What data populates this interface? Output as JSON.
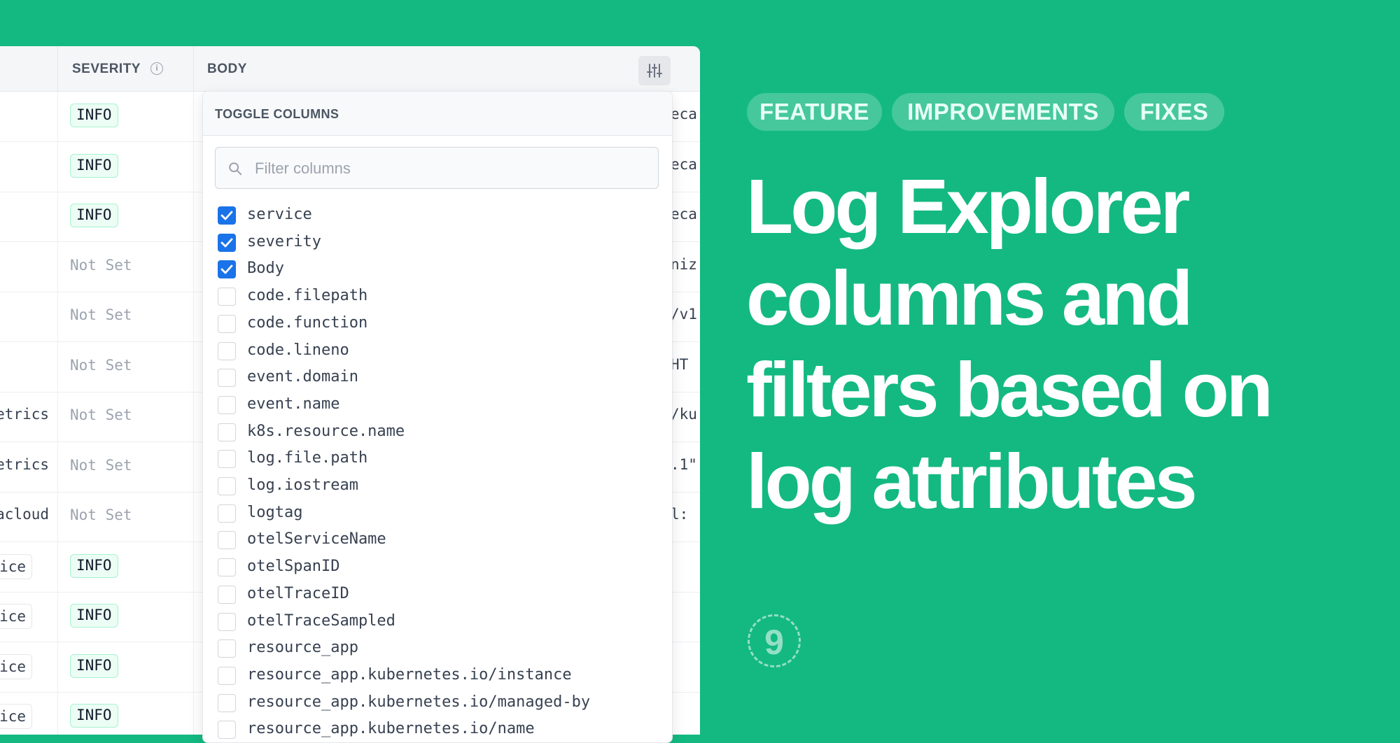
{
  "table": {
    "headers": {
      "severity": "SEVERITY",
      "body": "BODY"
    },
    "rows": [
      {
        "service": "",
        "severity": "INFO",
        "body": "eca"
      },
      {
        "service": "",
        "severity": "INFO",
        "body": "eca"
      },
      {
        "service": "",
        "severity": "INFO",
        "body": "eca"
      },
      {
        "service": "",
        "severity": "Not Set",
        "body": "niz"
      },
      {
        "service": "",
        "severity": "Not Set",
        "body": "/v1"
      },
      {
        "service": "",
        "severity": "Not Set",
        "body": " HT"
      },
      {
        "service": "etrics",
        "severity": "Not Set",
        "body": "/ku"
      },
      {
        "service": "etrics",
        "severity": "Not Set",
        "body": ".1\""
      },
      {
        "service": "acloud",
        "severity": "Not Set",
        "body": "l:"
      },
      {
        "service": "ice",
        "severity": "INFO",
        "body": ""
      },
      {
        "service": "ice",
        "severity": "INFO",
        "body": ""
      },
      {
        "service": "ice",
        "severity": "INFO",
        "body": ""
      },
      {
        "service": "ice",
        "severity": "INFO",
        "body": ""
      }
    ]
  },
  "toggle_columns": {
    "title": "TOGGLE COLUMNS",
    "filter_placeholder": "Filter columns",
    "options": [
      {
        "label": "service",
        "checked": true
      },
      {
        "label": "severity",
        "checked": true
      },
      {
        "label": "Body",
        "checked": true
      },
      {
        "label": "code.filepath",
        "checked": false
      },
      {
        "label": "code.function",
        "checked": false
      },
      {
        "label": "code.lineno",
        "checked": false
      },
      {
        "label": "event.domain",
        "checked": false
      },
      {
        "label": "event.name",
        "checked": false
      },
      {
        "label": "k8s.resource.name",
        "checked": false
      },
      {
        "label": "log.file.path",
        "checked": false
      },
      {
        "label": "log.iostream",
        "checked": false
      },
      {
        "label": "logtag",
        "checked": false
      },
      {
        "label": "otelServiceName",
        "checked": false
      },
      {
        "label": "otelSpanID",
        "checked": false
      },
      {
        "label": "otelTraceID",
        "checked": false
      },
      {
        "label": "otelTraceSampled",
        "checked": false
      },
      {
        "label": "resource_app",
        "checked": false
      },
      {
        "label": "resource_app.kubernetes.io/instance",
        "checked": false
      },
      {
        "label": "resource_app.kubernetes.io/managed-by",
        "checked": false
      },
      {
        "label": "resource_app.kubernetes.io/name",
        "checked": false
      }
    ]
  },
  "tags": [
    "FEATURE",
    "IMPROVEMENTS",
    "FIXES"
  ],
  "headline": "Log Explorer columns and filters based on log attributes",
  "badge_number": "9",
  "colors": {
    "background": "#13b981",
    "checkbox_checked": "#1a73e8",
    "info_badge_bg": "#ecfdf5",
    "info_badge_border": "#a7f3d0"
  }
}
